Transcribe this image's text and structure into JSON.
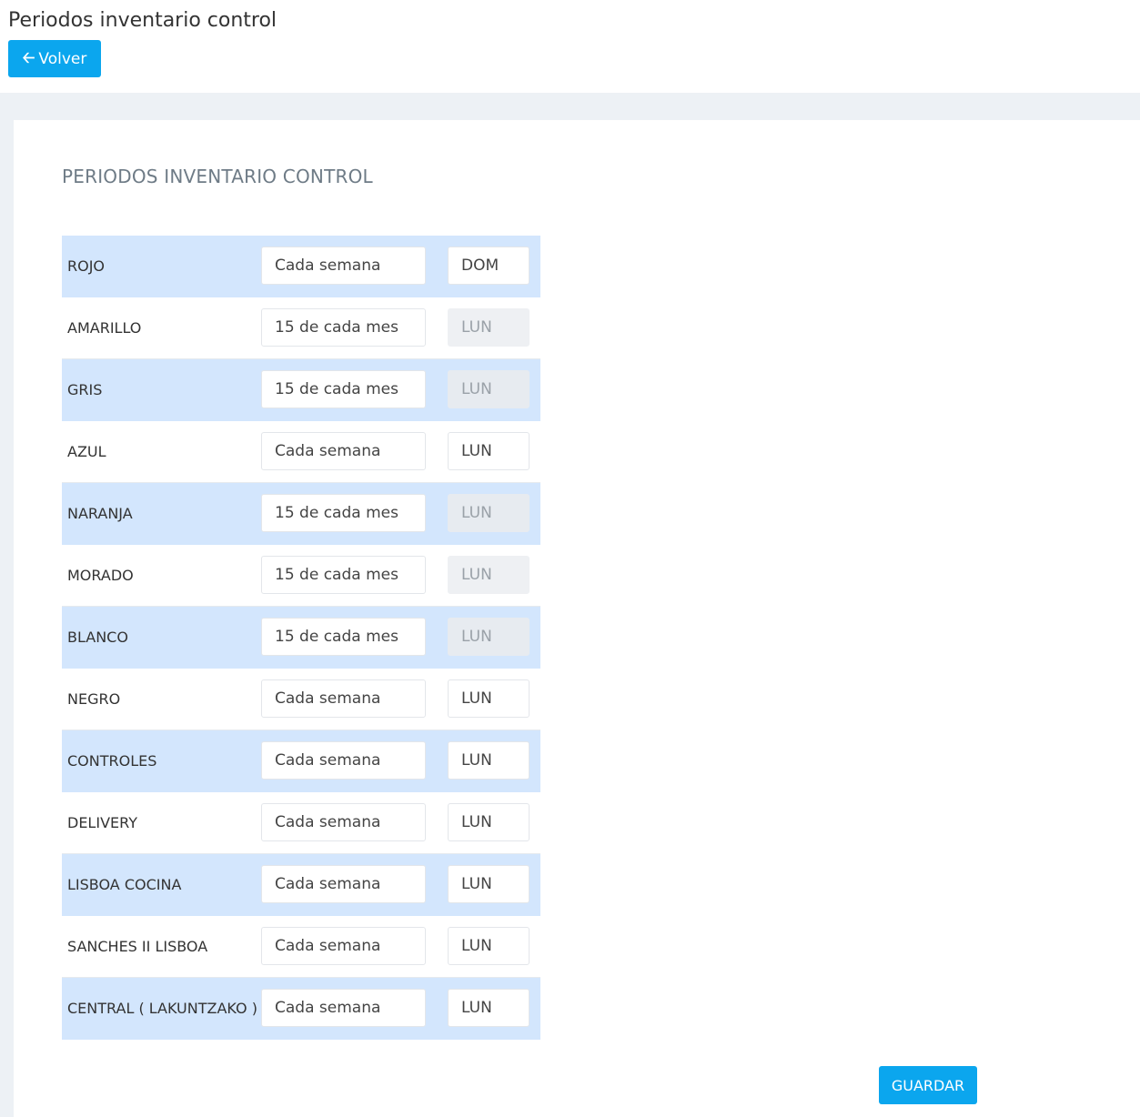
{
  "header": {
    "title": "Periodos inventario control",
    "back_label": "Volver",
    "back_icon": "arrow-left-icon"
  },
  "section": {
    "title": "PERIODOS INVENTARIO CONTROL"
  },
  "rows": [
    {
      "label": "ROJO",
      "period": "Cada semana",
      "day": "DOM",
      "day_disabled": false
    },
    {
      "label": "AMARILLO",
      "period": "15 de cada mes",
      "day": "LUN",
      "day_disabled": true
    },
    {
      "label": "GRIS",
      "period": "15 de cada mes",
      "day": "LUN",
      "day_disabled": true
    },
    {
      "label": "AZUL",
      "period": "Cada semana",
      "day": "LUN",
      "day_disabled": false
    },
    {
      "label": "NARANJA",
      "period": "15 de cada mes",
      "day": "LUN",
      "day_disabled": true
    },
    {
      "label": "MORADO",
      "period": "15 de cada mes",
      "day": "LUN",
      "day_disabled": true
    },
    {
      "label": "BLANCO",
      "period": "15 de cada mes",
      "day": "LUN",
      "day_disabled": true
    },
    {
      "label": "NEGRO",
      "period": "Cada semana",
      "day": "LUN",
      "day_disabled": false
    },
    {
      "label": "CONTROLES",
      "period": "Cada semana",
      "day": "LUN",
      "day_disabled": false
    },
    {
      "label": "DELIVERY",
      "period": "Cada semana",
      "day": "LUN",
      "day_disabled": false
    },
    {
      "label": "LISBOA COCINA",
      "period": "Cada semana",
      "day": "LUN",
      "day_disabled": false
    },
    {
      "label": "SANCHES II LISBOA",
      "period": "Cada semana",
      "day": "LUN",
      "day_disabled": false
    },
    {
      "label": "CENTRAL ( LAKUNTZAKO )",
      "period": "Cada semana",
      "day": "LUN",
      "day_disabled": false
    }
  ],
  "footer": {
    "save_label": "GUARDAR"
  },
  "colors": {
    "primary": "#0ba6ee",
    "row_highlight": "#d3e6fd",
    "page_background": "#edf1f5"
  }
}
